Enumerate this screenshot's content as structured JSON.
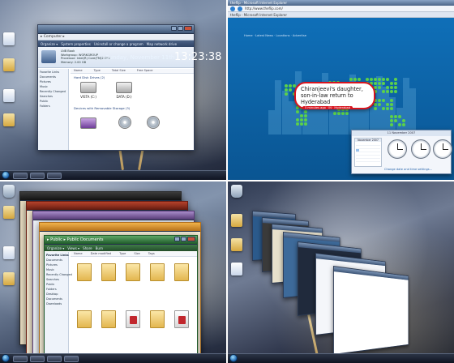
{
  "quad_tl": {
    "explorer": {
      "address": "▸ Computer ▸",
      "search_placeholder": "Search",
      "commands": [
        "Organize ▾",
        "System properties",
        "Uninstall or change a program",
        "Map network drive",
        "Open Control Panel"
      ],
      "info": [
        "LNB Book",
        "Workgroup: WORKGROUP",
        "Processor: Intel(R) Core(TM)2 CPU",
        "Memory: 2.00 GB"
      ],
      "columns": [
        "Name",
        "Type",
        "Total Size",
        "Free Space"
      ],
      "group_hdd": "Hard Disk Drives (2)",
      "group_removable": "Devices with Removable Storage (3)",
      "drives": [
        "VISTA (C:)",
        "DATA (D:)",
        "",
        "",
        ""
      ],
      "nav": [
        "Favorite Links",
        "Documents",
        "Pictures",
        "Music",
        "Recently Changed",
        "Searches",
        "Public",
        "Folders"
      ]
    },
    "taskbar_time": ""
  },
  "quad_tr": {
    "ie": {
      "title": "theflip - Microsoft Internet Explorer",
      "tab": "theflip - Microsoft Internet Explorer",
      "address": "http://www.theflip.com/",
      "menu": "Home  ·  Latest News  ·  Locations  ·  Advertise"
    },
    "date": "Sunday, November 11th",
    "time": "13:23:38",
    "headline": "Chiranjeevi's daughter, son-in-law return to Hyderabad",
    "headline_tag": "5 minutes ago · IN · Hyderabad",
    "gadget": {
      "title": "11 November 2007",
      "calendar_month": "November 2007",
      "clocks": [
        "",
        "",
        ""
      ],
      "link": "Change date and time settings..."
    }
  },
  "quad_bl": {
    "folder_window": {
      "address": "▸ Public ▸ Public Documents",
      "commands": [
        "Organize ▾",
        "Views ▾",
        "Share",
        "Burn"
      ],
      "columns": [
        "Name",
        "Date modified",
        "Type",
        "Size",
        "Tags"
      ],
      "nav_title": "Favorite Links",
      "nav": [
        "Documents",
        "Pictures",
        "Music",
        "Recently Changed",
        "Searches",
        "Public",
        "Folders",
        "Desktop",
        "Documents",
        "Downloads"
      ],
      "items": [
        "",
        "",
        "",
        "",
        "",
        "",
        "",
        "",
        "",
        ""
      ]
    }
  },
  "quad_br": {
    "flip_windows": [
      "",
      "",
      "",
      "",
      "",
      "",
      ""
    ]
  }
}
